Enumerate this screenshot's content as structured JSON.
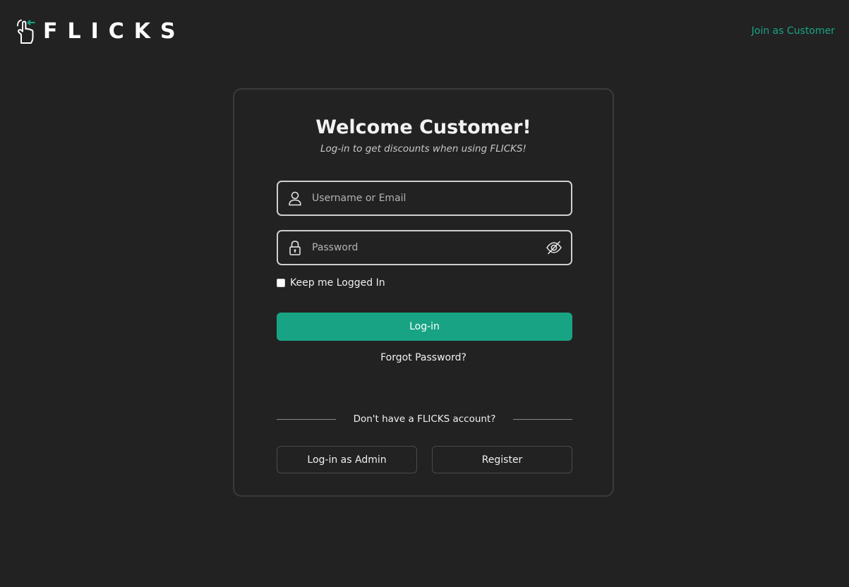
{
  "header": {
    "logo_text": "FLICKS",
    "logo_icon": "tap-hand-icon",
    "join_link": "Join as Customer"
  },
  "login_card": {
    "title": "Welcome Customer!",
    "subtitle": "Log-in to get discounts when using FLICKS!",
    "username_field": {
      "placeholder": "Username or Email",
      "value": "",
      "icon": "user-icon"
    },
    "password_field": {
      "placeholder": "Password",
      "value": "",
      "icon": "lock-icon",
      "toggle_icon": "eye-slash-icon"
    },
    "keep_logged_in": {
      "label": "Keep me Logged In",
      "checked": false
    },
    "login_button": "Log-in",
    "forgot_password": "Forgot Password?",
    "divider_text": "Don't have a FLICKS account?",
    "admin_button": "Log-in as Admin",
    "register_button": "Register"
  },
  "colors": {
    "background": "#222222",
    "accent": "#18a484",
    "card_border": "#3b3b3b",
    "field_border": "#cfcfcf"
  }
}
